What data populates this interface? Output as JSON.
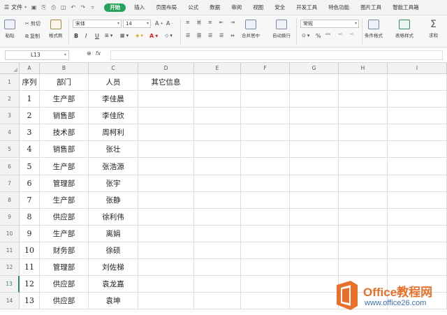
{
  "menubar": {
    "file_label": "文件",
    "tabs": [
      "开始",
      "插入",
      "页面布局",
      "公式",
      "数据",
      "审阅",
      "视图",
      "安全",
      "开发工具",
      "特色功能",
      "图片工具",
      "智能工具箱"
    ],
    "active_tab": "开始"
  },
  "ribbon": {
    "paste": "粘贴",
    "cut": "剪切",
    "copy": "复制",
    "format_painter": "格式刷",
    "font_name": "宋体",
    "font_size": "14",
    "bold": "B",
    "italic": "I",
    "underline": "U",
    "merge_center": "合并居中",
    "wrap_text": "自动换行",
    "number_format": "常规",
    "percent": "%",
    "conditional_format": "条件格式",
    "table_style": "表格样式",
    "sum": "求和"
  },
  "formula_bar": {
    "cell_ref": "L13",
    "fx": "fx",
    "formula": ""
  },
  "sheet": {
    "columns": [
      "A",
      "B",
      "C",
      "D",
      "E",
      "F",
      "G",
      "H",
      "I"
    ],
    "row_numbers": [
      "1",
      "2",
      "3",
      "4",
      "5",
      "6",
      "7",
      "8",
      "9",
      "10",
      "11",
      "12",
      "13",
      "14"
    ],
    "selected_row": "13",
    "rows": [
      [
        "序列",
        "部门",
        "人员",
        "其它信息"
      ],
      [
        "1",
        "生产部",
        "李佳晨",
        ""
      ],
      [
        "2",
        "销售部",
        "李佳欣",
        ""
      ],
      [
        "3",
        "技术部",
        "周柯利",
        ""
      ],
      [
        "4",
        "销售部",
        "张壮",
        ""
      ],
      [
        "5",
        "生产部",
        "张浩源",
        ""
      ],
      [
        "6",
        "管理部",
        "张宇",
        ""
      ],
      [
        "7",
        "生产部",
        "张静",
        ""
      ],
      [
        "8",
        "供应部",
        "徐利伟",
        ""
      ],
      [
        "9",
        "生产部",
        "离娟",
        ""
      ],
      [
        "10",
        "财务部",
        "徐硕",
        ""
      ],
      [
        "11",
        "管理部",
        "刘佐梯",
        ""
      ],
      [
        "12",
        "供应部",
        "袁龙嘉",
        ""
      ],
      [
        "13",
        "供应部",
        "袁坤",
        ""
      ]
    ]
  },
  "watermark": {
    "title": "Office教程网",
    "url": "www.office26.com"
  },
  "colors": {
    "accent_green": "#25a35a",
    "watermark_orange": "#e8702a",
    "watermark_blue": "#3a6fb0"
  }
}
